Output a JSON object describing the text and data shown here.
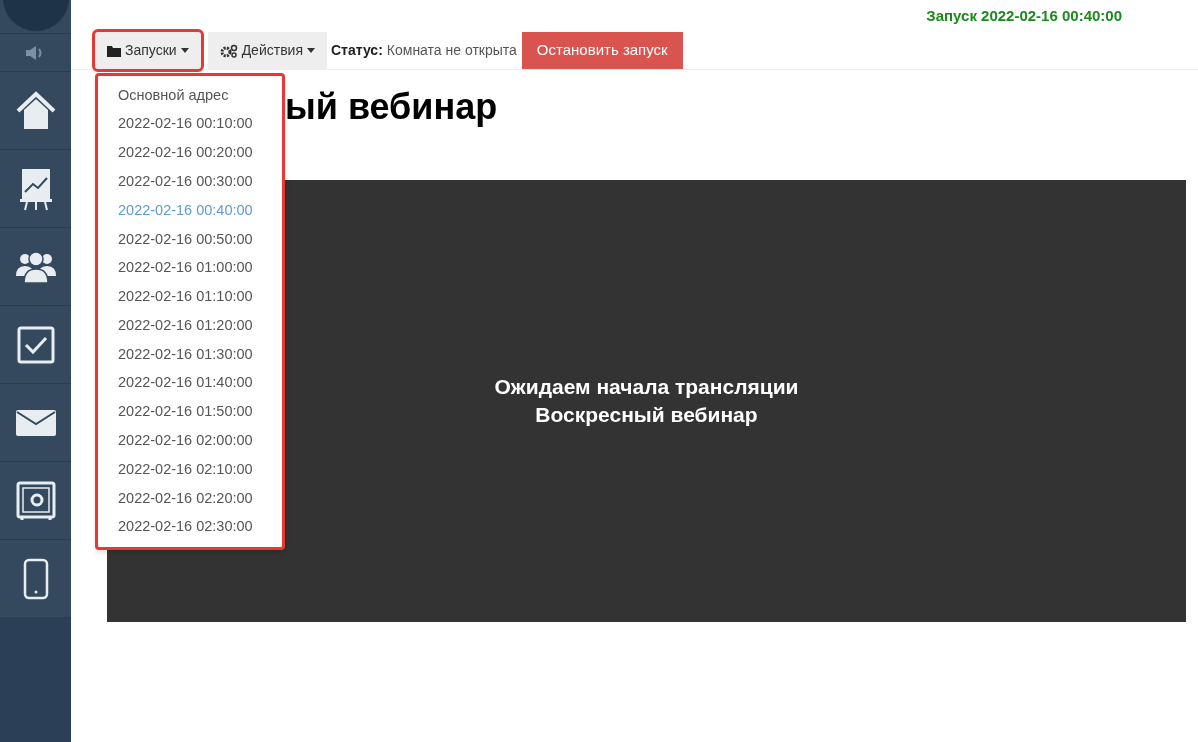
{
  "header": {
    "launch_info": "Запуск 2022-02-16 00:40:00"
  },
  "sidebar": {
    "items": [
      {
        "kind": "sound"
      },
      {
        "kind": "home"
      },
      {
        "kind": "chart"
      },
      {
        "kind": "users"
      },
      {
        "kind": "tasks"
      },
      {
        "kind": "mail"
      },
      {
        "kind": "safe"
      },
      {
        "kind": "phone"
      }
    ]
  },
  "toolbar": {
    "launches_button": {
      "label": "Запуски",
      "highlighted": true,
      "expanded": true
    },
    "actions_button": {
      "label": "Действия"
    },
    "status_label": "Статус:",
    "status_value": "Комната не открыта",
    "stop_button": "Остановить запуск"
  },
  "launches_menu": {
    "highlighted": true,
    "items": [
      {
        "label": "Основной адрес",
        "selected": false
      },
      {
        "label": "2022-02-16 00:10:00",
        "selected": false
      },
      {
        "label": "2022-02-16 00:20:00",
        "selected": false
      },
      {
        "label": "2022-02-16 00:30:00",
        "selected": false
      },
      {
        "label": "2022-02-16 00:40:00",
        "selected": true
      },
      {
        "label": "2022-02-16 00:50:00",
        "selected": false
      },
      {
        "label": "2022-02-16 01:00:00",
        "selected": false
      },
      {
        "label": "2022-02-16 01:10:00",
        "selected": false
      },
      {
        "label": "2022-02-16 01:20:00",
        "selected": false
      },
      {
        "label": "2022-02-16 01:30:00",
        "selected": false
      },
      {
        "label": "2022-02-16 01:40:00",
        "selected": false
      },
      {
        "label": "2022-02-16 01:50:00",
        "selected": false
      },
      {
        "label": "2022-02-16 02:00:00",
        "selected": false
      },
      {
        "label": "2022-02-16 02:10:00",
        "selected": false
      },
      {
        "label": "2022-02-16 02:20:00",
        "selected": false
      },
      {
        "label": "2022-02-16 02:30:00",
        "selected": false
      }
    ]
  },
  "page_title": "ый вебинар",
  "player": {
    "lines": [
      "Ожидаем начала трансляции",
      "Воскресный вебинар"
    ]
  }
}
